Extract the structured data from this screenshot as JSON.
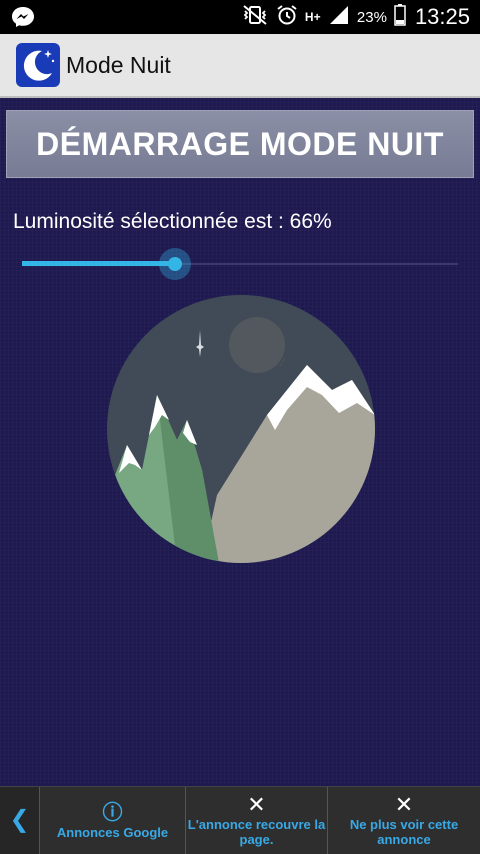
{
  "status_bar": {
    "battery_percent": "23%",
    "time": "13:25",
    "network_type": "H+"
  },
  "app_bar": {
    "title": "Mode Nuit"
  },
  "main": {
    "start_button_label": "DÉMARRAGE MODE NUIT",
    "brightness_label": "Luminosité sélectionnée est : 66%",
    "brightness_value": 0.35
  },
  "ad_bar": {
    "google_label": "Annonces Google",
    "covers_label": "L'annonce recouvre la page.",
    "hide_label": "Ne plus voir cette annonce"
  },
  "colors": {
    "background": "#1e1a50",
    "accent": "#33b5e5",
    "button": "#8086a0"
  }
}
